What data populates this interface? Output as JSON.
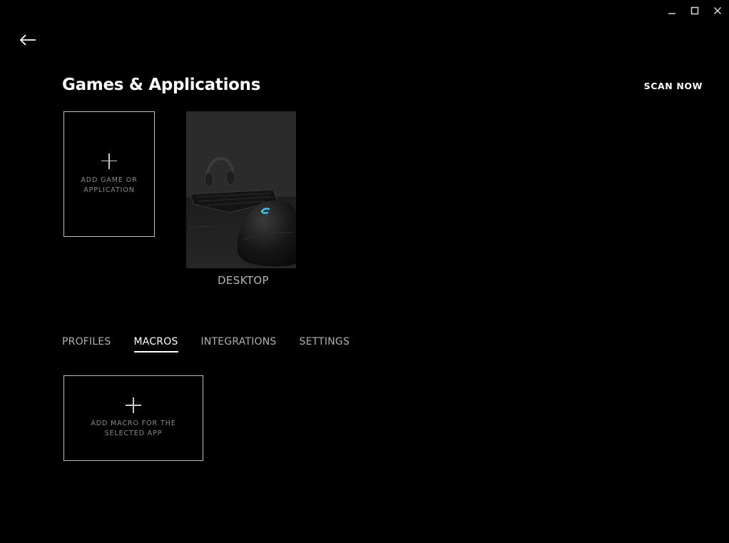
{
  "window": {
    "minimize_icon": "minimize-icon",
    "maximize_icon": "maximize-icon",
    "close_icon": "close-icon"
  },
  "nav": {
    "back_icon": "arrow-left-icon"
  },
  "header": {
    "title": "Games & Applications",
    "scan_label": "SCAN NOW"
  },
  "apps": {
    "add_tile_label": "ADD GAME OR\nAPPLICATION",
    "items": [
      {
        "label": "DESKTOP",
        "image": "gaming-mouse-and-keyboard-photo"
      }
    ]
  },
  "tabs": [
    {
      "label": "PROFILES",
      "active": false
    },
    {
      "label": "MACROS",
      "active": true
    },
    {
      "label": "INTEGRATIONS",
      "active": false
    },
    {
      "label": "SETTINGS",
      "active": false
    }
  ],
  "macros": {
    "add_tile_label": "ADD MACRO FOR THE\nSELECTED APP"
  },
  "colors": {
    "background": "#000000",
    "text": "#ffffff",
    "muted_text": "#8a8a8a",
    "tile_border": "#bdbdbd",
    "accent_glow": "#3ec8ff"
  }
}
